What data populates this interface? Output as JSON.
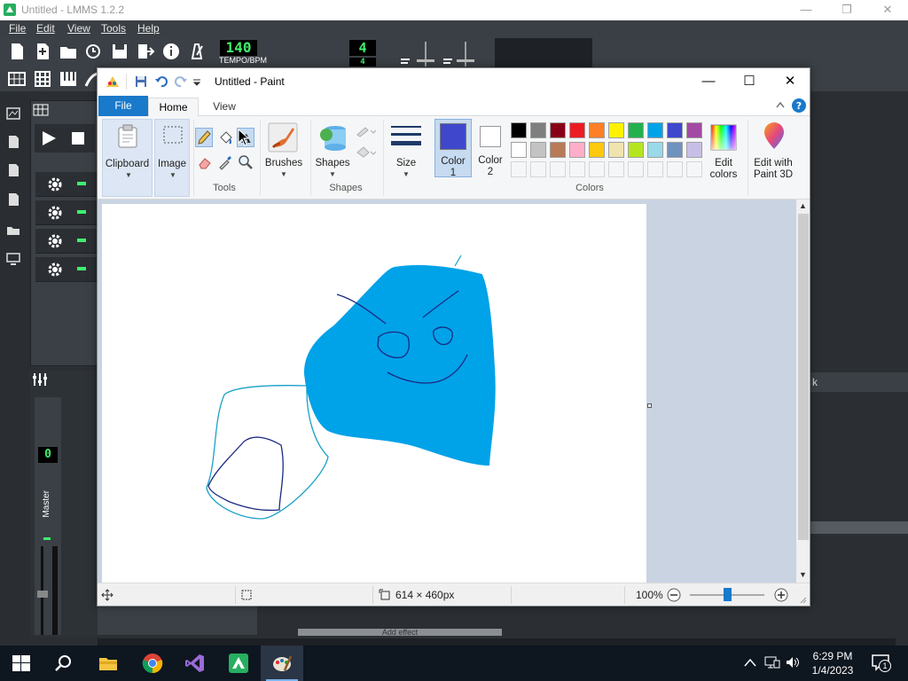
{
  "lmms": {
    "title": "Untitled - LMMS 1.2.2",
    "menu": [
      "File",
      "Edit",
      "View",
      "Tools",
      "Help"
    ],
    "tempo_value": "140",
    "tempo_label": "TEMPO/BPM",
    "time_sig_top": "4",
    "time_sig_bottom": "4",
    "master_label": "Master",
    "mixer_lcd": "0",
    "peek_text": "k",
    "add_effect_label": "Add effect"
  },
  "paint": {
    "title": "Untitled - Paint",
    "tabs": {
      "file": "File",
      "home": "Home",
      "view": "View"
    },
    "ribbon": {
      "clipboard": "Clipboard",
      "image": "Image",
      "tools": "Tools",
      "brushes": "Brushes",
      "shapes_btn": "Shapes",
      "shapes_group": "Shapes",
      "size": "Size",
      "color1_line1": "Color",
      "color1_line2": "1",
      "color2_line1": "Color",
      "color2_line2": "2",
      "colors_group": "Colors",
      "edit_colors_line1": "Edit",
      "edit_colors_line2": "colors",
      "paint3d_line1": "Edit with",
      "paint3d_line2": "Paint 3D"
    },
    "color1": "#3f48cc",
    "color2": "#ffffff",
    "palette_row1": [
      "#000000",
      "#7f7f7f",
      "#880015",
      "#ed1c24",
      "#ff7f27",
      "#fff200",
      "#22b14c",
      "#00a2e8",
      "#3f48cc",
      "#a349a4"
    ],
    "palette_row2": [
      "#ffffff",
      "#c3c3c3",
      "#b97a57",
      "#ffaec9",
      "#ffc90e",
      "#efe4b0",
      "#b5e61d",
      "#99d9ea",
      "#7092be",
      "#c8bfe7"
    ],
    "status": {
      "dimensions": "614 × 460px",
      "zoom": "100%"
    },
    "zoom_level": 100
  },
  "taskbar": {
    "time": "6:29 PM",
    "date": "1/4/2023",
    "notification_count": "1"
  }
}
